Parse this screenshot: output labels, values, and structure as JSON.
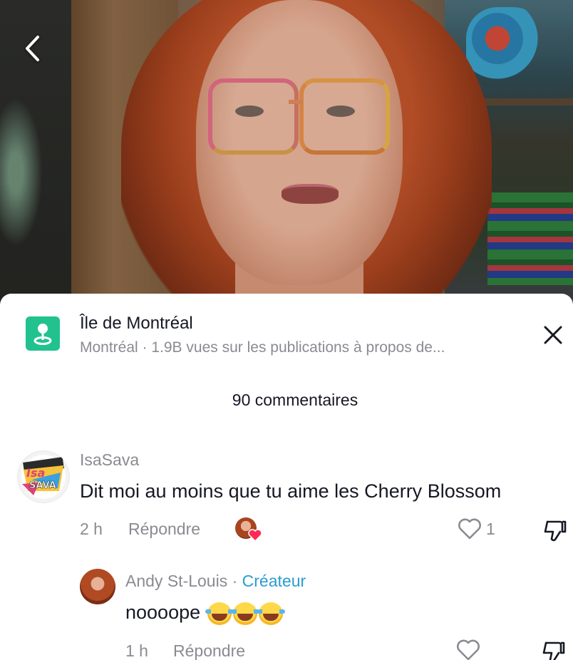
{
  "location": {
    "title": "Île de Montréal",
    "subtitle": "Montréal · 1.9B vues sur les publications à propos de..."
  },
  "comments_count": "90 commentaires",
  "comments": [
    {
      "username": "IsaSava",
      "text": "Dit moi au moins que tu aime les Cherry Blossom",
      "time": "2 h",
      "reply_label": "Répondre",
      "likes": "1"
    },
    {
      "username": "Andy St-Louis",
      "separator": " · ",
      "badge": "Créateur",
      "text": "noooope",
      "time": "1 h",
      "reply_label": "Répondre"
    }
  ],
  "avatar_logo": {
    "line1": "Isa",
    "line2": "SAVA"
  },
  "icons": {
    "back": "chevron-left-icon",
    "location": "map-pin-icon",
    "close": "close-icon",
    "like": "heart-outline-icon",
    "dislike": "thumbs-down-icon",
    "creator_liked": "heart-badge-icon",
    "emoji": "tears-of-joy-emoji"
  },
  "colors": {
    "accent_green": "#21c28e",
    "creator_blue": "#2b9cd0",
    "like_red": "#fe2c55",
    "text_primary": "#161823",
    "text_secondary": "#8a8b91"
  }
}
